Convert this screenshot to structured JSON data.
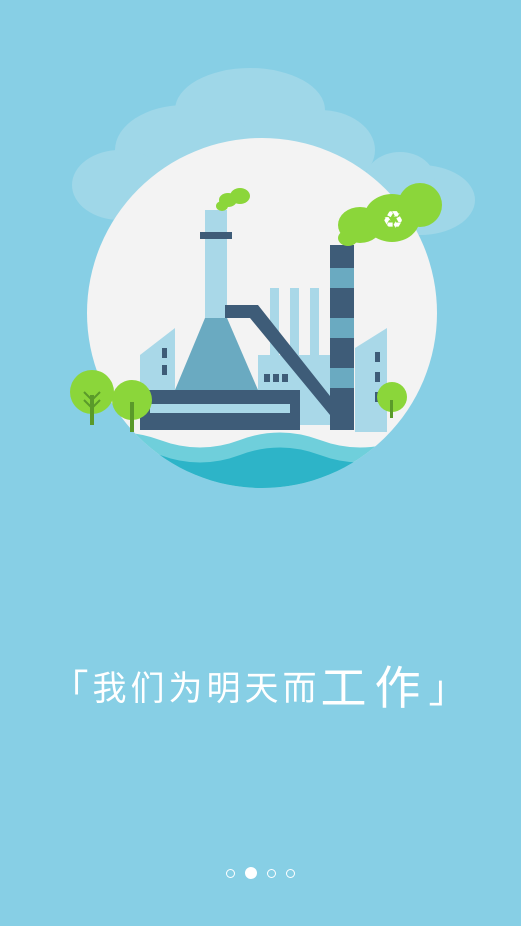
{
  "illustration": {
    "name": "factory-illustration",
    "icons": [
      "cloud-icon",
      "factory-icon",
      "recycle-icon",
      "tree-icon",
      "water-wave-icon"
    ],
    "colors": {
      "background": "#87CFE5",
      "circle": "#F3F3F3",
      "water": "#2DB4C8",
      "green": "#8BD63A",
      "building_dark": "#3E5C78",
      "building_light": "#A9D8E8"
    }
  },
  "slogan": {
    "open_bracket": "「",
    "text_small": "我们为明天而",
    "text_large": "工作",
    "close_bracket": "」"
  },
  "pager": {
    "total": 4,
    "active_index": 1
  }
}
